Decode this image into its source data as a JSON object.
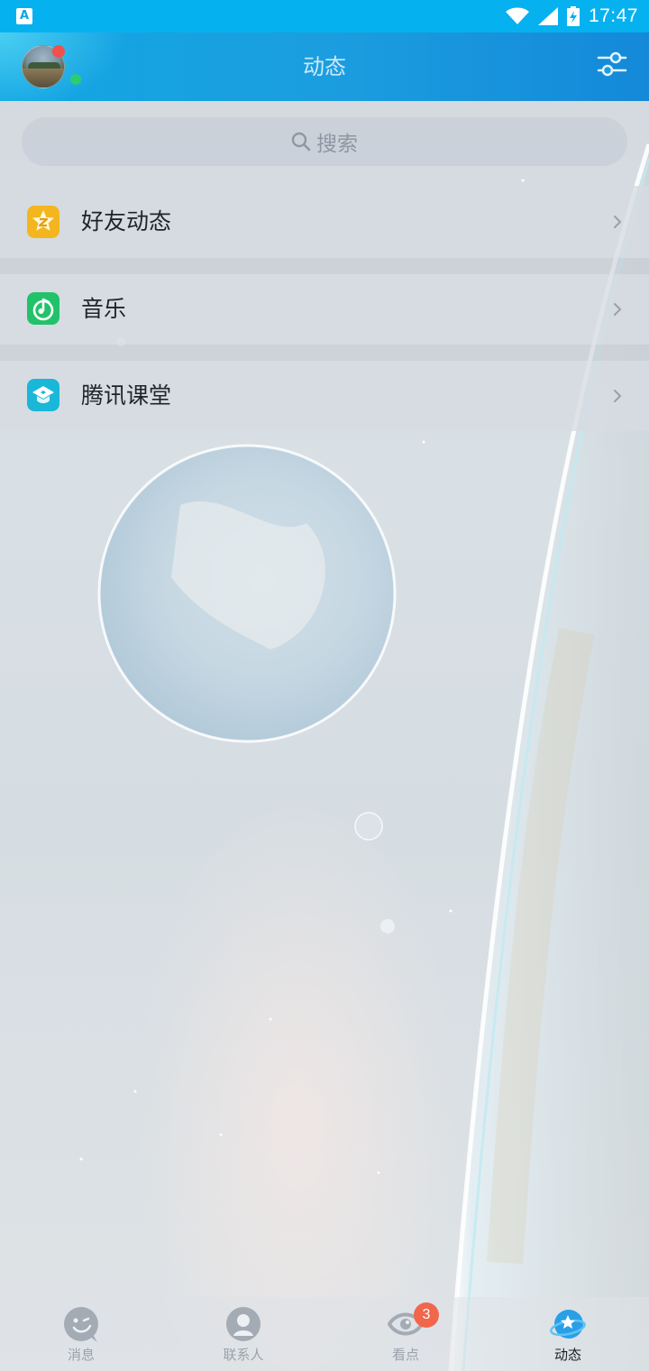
{
  "status_bar": {
    "notification_icon": "A",
    "time": "17:47",
    "icons": [
      "wifi-icon",
      "signal-icon",
      "battery-charging-icon"
    ]
  },
  "header": {
    "title": "动态",
    "left": "avatar",
    "right_icon": "settings-sliders-icon"
  },
  "search": {
    "placeholder": "搜索",
    "icon": "search-icon"
  },
  "feature_list": [
    {
      "label": "好友动态",
      "icon": "qzone-star-icon",
      "color": "#f3b61f"
    },
    {
      "label": "音乐",
      "icon": "music-note-icon",
      "color": "#22c26a"
    },
    {
      "label": "腾讯课堂",
      "icon": "graduation-cap-icon",
      "color": "#19b7d8"
    }
  ],
  "tab_bar": {
    "tabs": [
      {
        "label": "消息",
        "icon": "message-face-icon"
      },
      {
        "label": "联系人",
        "icon": "contact-person-icon"
      },
      {
        "label": "看点",
        "icon": "eye-icon",
        "badge": "3"
      },
      {
        "label": "动态",
        "icon": "planet-star-icon",
        "active": true
      }
    ]
  },
  "colors": {
    "header": "#13a6e3",
    "status_bar": "#06b1f0",
    "badge": "#f2664c"
  }
}
